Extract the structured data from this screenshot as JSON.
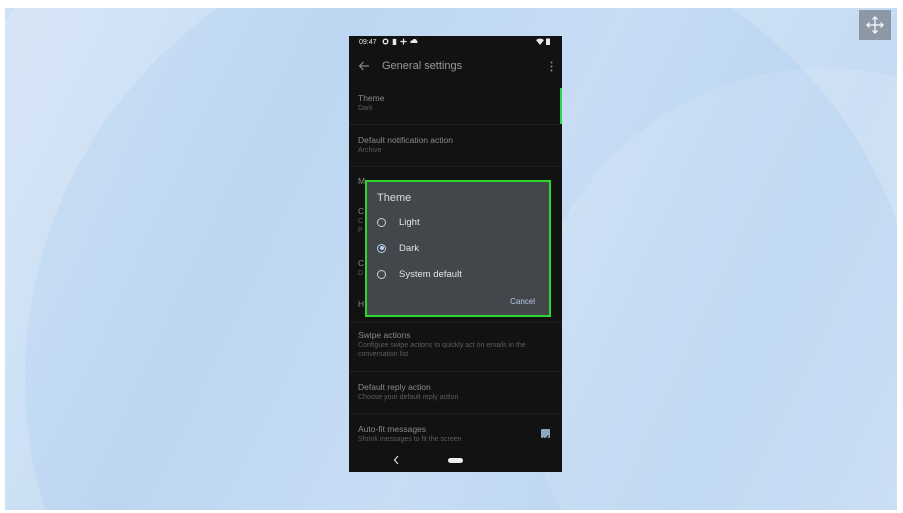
{
  "status_bar": {
    "time": "09:47"
  },
  "app_bar": {
    "title": "General settings"
  },
  "settings": [
    {
      "title": "Theme",
      "subtitle": "Dark"
    },
    {
      "title": "Default notification action",
      "subtitle": "Archive"
    },
    {
      "title": "M",
      "subtitle": ""
    },
    {
      "title": "C",
      "subtitle": "C\nP"
    },
    {
      "title": "C",
      "subtitle": "D"
    },
    {
      "title": "H",
      "subtitle": ""
    },
    {
      "title": "Swipe actions",
      "subtitle": "Configure swipe actions to quickly act on emails in the conversation list"
    },
    {
      "title": "Default reply action",
      "subtitle": "Choose your default reply action"
    },
    {
      "title": "Auto-fit messages",
      "subtitle": "Shrink messages to fit the screen"
    }
  ],
  "dialog": {
    "title": "Theme",
    "options": [
      {
        "label": "Light",
        "selected": false
      },
      {
        "label": "Dark",
        "selected": true
      },
      {
        "label": "System default",
        "selected": false
      }
    ],
    "cancel_label": "Cancel"
  },
  "colors": {
    "highlight": "#2bd82b",
    "accent_text": "#b8cbf0",
    "dialog_bg": "#43464b",
    "screen_bg": "#121212"
  }
}
